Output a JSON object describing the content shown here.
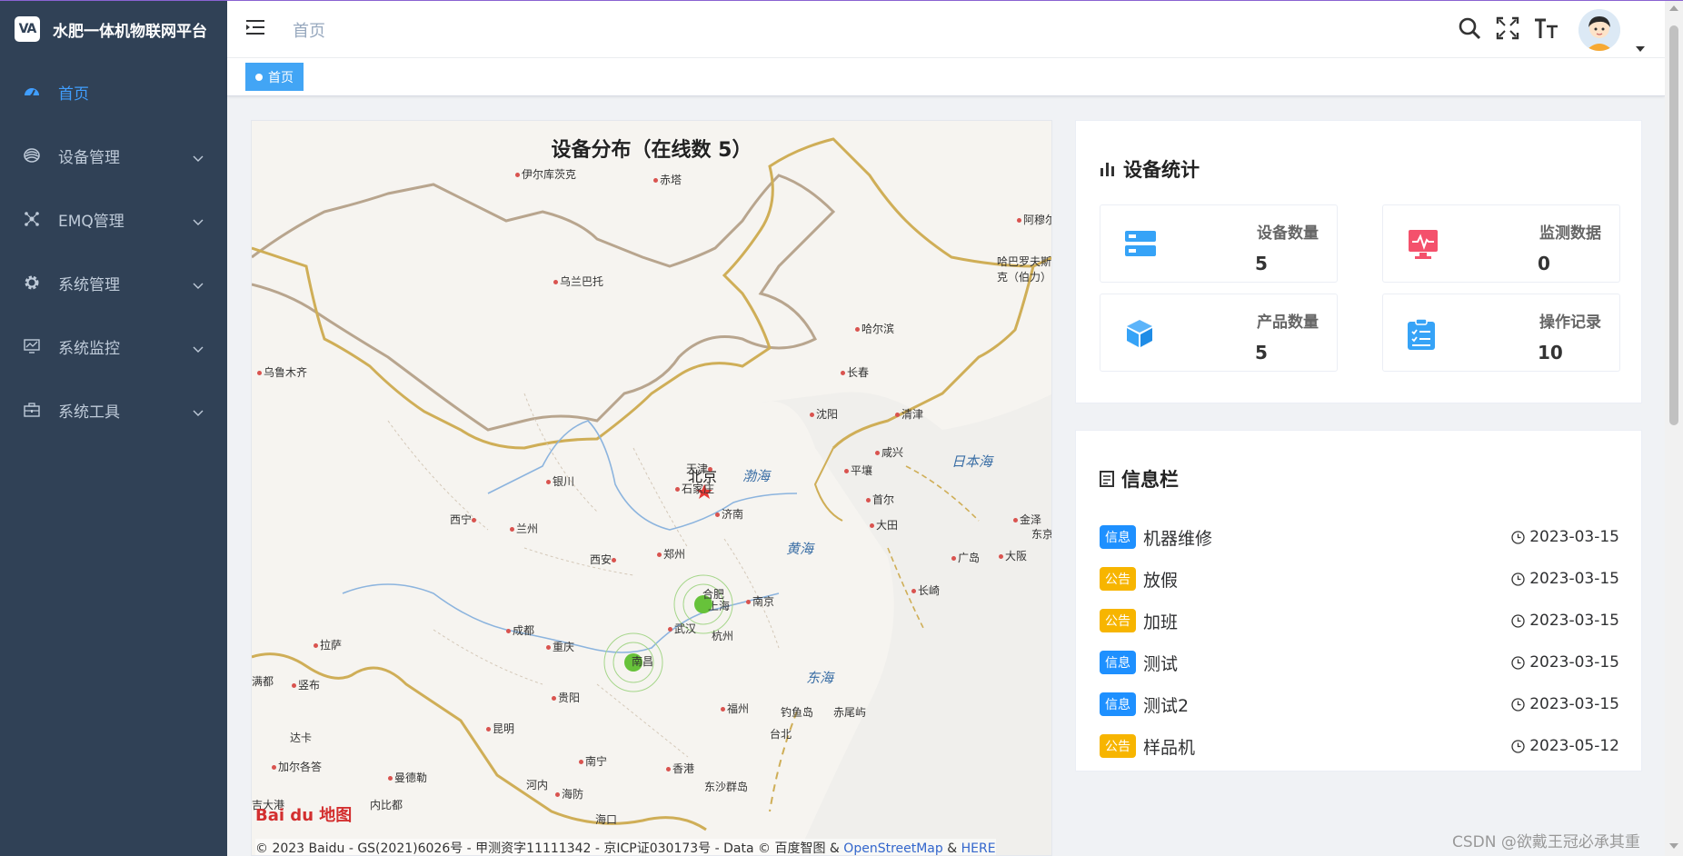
{
  "app": {
    "title": "水肥一体机物联网平台",
    "logo_text": "VA"
  },
  "sidebar": {
    "items": [
      {
        "label": "首页",
        "icon": "dashboard-icon",
        "active": true,
        "expandable": false
      },
      {
        "label": "设备管理",
        "icon": "layers-icon",
        "active": false,
        "expandable": true
      },
      {
        "label": "EMQ管理",
        "icon": "network-icon",
        "active": false,
        "expandable": true
      },
      {
        "label": "系统管理",
        "icon": "gear-icon",
        "active": false,
        "expandable": true
      },
      {
        "label": "系统监控",
        "icon": "monitor-icon",
        "active": false,
        "expandable": true
      },
      {
        "label": "系统工具",
        "icon": "toolbox-icon",
        "active": false,
        "expandable": true
      }
    ]
  },
  "header": {
    "breadcrumb": "首页",
    "icons": [
      "search-icon",
      "fullscreen-icon",
      "font-size-icon"
    ]
  },
  "tags": [
    {
      "label": "首页",
      "active": true
    }
  ],
  "map": {
    "title": "设备分布（在线数 5）",
    "capital": "北京",
    "cities": [
      "伊尔库茨克",
      "赤塔",
      "阿穆尔",
      "哈巴罗夫斯克（伯力）",
      "乌兰巴托",
      "哈尔滨",
      "乌鲁木齐",
      "长春",
      "沈阳",
      "清津",
      "咸兴",
      "天津",
      "平壤",
      "银川",
      "石家庄",
      "首尔",
      "西宁",
      "兰州",
      "济南",
      "大田",
      "金泽",
      "东京",
      "西安",
      "郑州",
      "广岛",
      "大阪",
      "长崎",
      "合肥",
      "南京",
      "上海",
      "武汉",
      "杭州",
      "成都",
      "重庆",
      "拉萨",
      "南昌",
      "满都",
      "竖布",
      "贵阳",
      "福州",
      "钓鱼岛",
      "赤尾屿",
      "台北",
      "达卡",
      "昆明",
      "加尔各答",
      "曼德勒",
      "南宁",
      "香港",
      "河内",
      "东沙群岛",
      "内比都",
      "海防",
      "海口",
      "吉大港"
    ],
    "seas": [
      "渤海",
      "日本海",
      "黄海",
      "东海"
    ],
    "baidu_logo": "Bai du 地图",
    "copyright": "© 2023 Baidu - GS(2021)6026号 - 甲测资字11111342 - 京ICP证030173号 - Data © 百度智图 &",
    "link1": "OpenStreetMap",
    "amp": "&",
    "link2": "HERE",
    "markers_color": "#67c23a"
  },
  "stats": {
    "title": "设备统计",
    "items": [
      {
        "label": "设备数量",
        "value": "5",
        "icon": "server-icon",
        "color": "#36a3f7"
      },
      {
        "label": "监测数据",
        "value": "0",
        "icon": "pulse-monitor-icon",
        "color": "#f4516c"
      },
      {
        "label": "产品数量",
        "value": "5",
        "icon": "cube-icon",
        "color": "#36a3f7"
      },
      {
        "label": "操作记录",
        "value": "10",
        "icon": "clipboard-list-icon",
        "color": "#36a3f7"
      }
    ]
  },
  "info": {
    "title": "信息栏",
    "items": [
      {
        "type": "信息",
        "kind": "info",
        "title": "机器维修",
        "date": "2023-03-15"
      },
      {
        "type": "公告",
        "kind": "notice",
        "title": "放假",
        "date": "2023-03-15"
      },
      {
        "type": "公告",
        "kind": "notice",
        "title": "加班",
        "date": "2023-03-15"
      },
      {
        "type": "信息",
        "kind": "info",
        "title": "测试",
        "date": "2023-03-15"
      },
      {
        "type": "信息",
        "kind": "info",
        "title": "测试2",
        "date": "2023-03-15"
      },
      {
        "type": "公告",
        "kind": "notice",
        "title": "样品机",
        "date": "2023-05-12"
      }
    ]
  },
  "watermark": "CSDN @欲戴王冠必承其重"
}
